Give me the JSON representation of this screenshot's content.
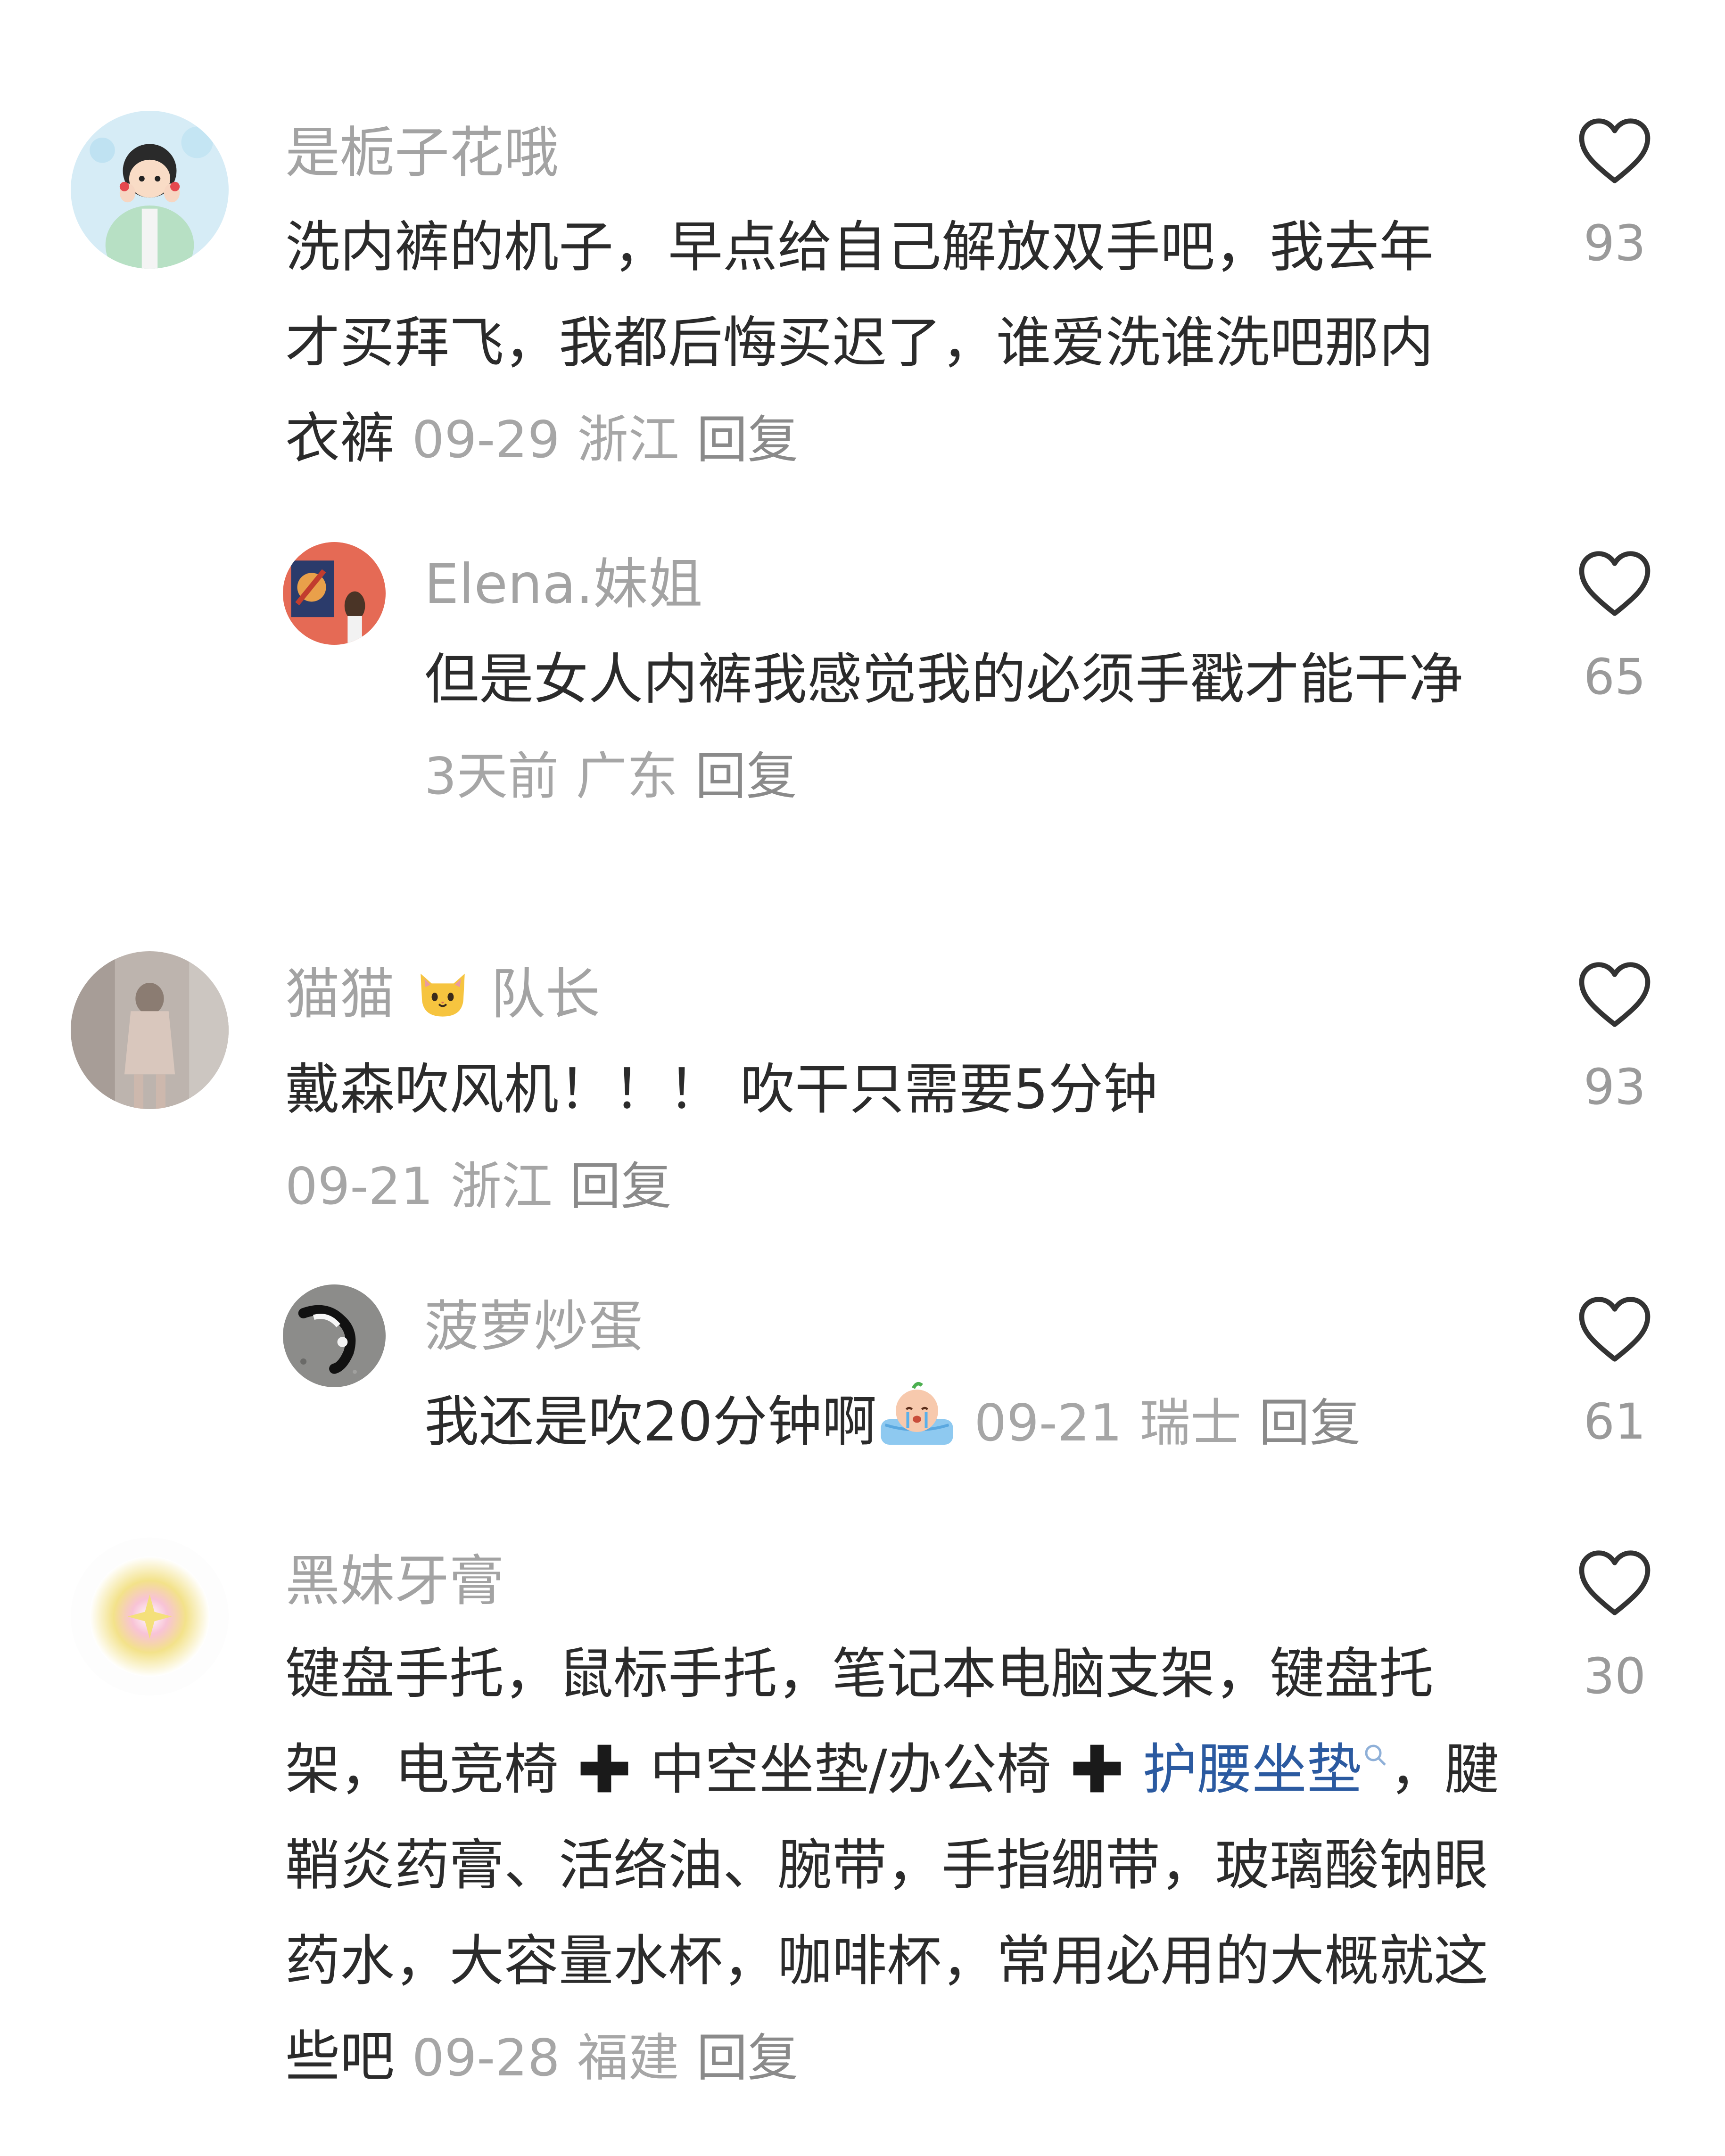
{
  "comments": [
    {
      "username": "是栀子花哦",
      "text": "洗内裤的机子，早点给自己解放双手吧，我去年才买拜飞，我都后悔买迟了，谁爱洗谁洗吧那内衣裤",
      "date": "09-29",
      "location": "浙江",
      "reply_label": "回复",
      "likes": "93",
      "replies": [
        {
          "username": "Elena.妹姐",
          "text": "但是女人内裤我感觉我的必须手戳才能干净",
          "date": "3天前",
          "location": "广东",
          "reply_label": "回复",
          "likes": "65"
        }
      ]
    },
    {
      "username_prefix": "猫猫",
      "username_suffix": "队长",
      "username_emoji": "cat-face-emoji",
      "text": "戴森吹风机！！！ 吹干只需要5分钟",
      "date": "09-21",
      "location": "浙江",
      "reply_label": "回复",
      "likes": "93",
      "replies": [
        {
          "username": "菠萝炒蛋",
          "text": "我还是吹20分钟啊",
          "text_emoji": "crying-face-emoji",
          "date": "09-21",
          "location": "瑞士",
          "reply_label": "回复",
          "likes": "61"
        }
      ]
    },
    {
      "username": "黑妹牙膏",
      "text_part1": "键盘手托，鼠标手托，笔记本电脑支架，键盘托架，电竞椅",
      "plus_icon": "heavy-plus-icon",
      "text_part2": "中空坐垫/办公椅",
      "link_text": "护腰坐垫",
      "link_icon": "search-icon",
      "text_part3": "，腱鞘炎药膏、活络油、腕带，手指绷带，玻璃酸钠眼药水，大容量水杯，咖啡杯，常用必用的大概就这些吧",
      "date": "09-28",
      "location": "福建",
      "reply_label": "回复",
      "likes": "30",
      "link_color": "#2b5aa0"
    }
  ]
}
